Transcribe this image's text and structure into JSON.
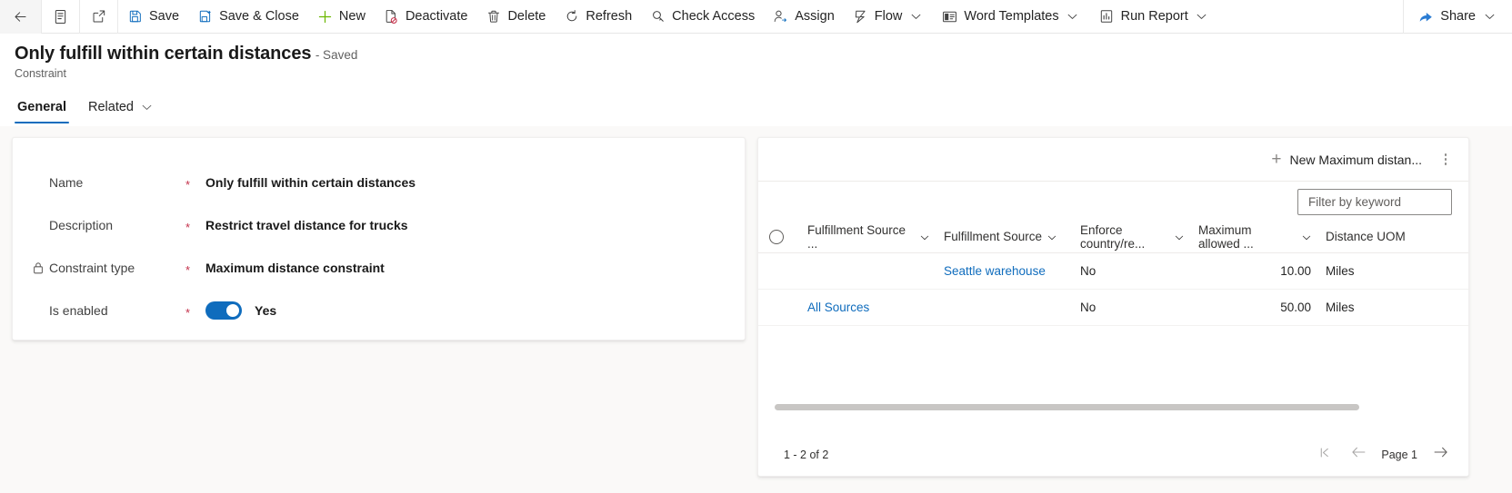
{
  "commandbar": {
    "back": {
      "label": "",
      "icon": "back-arrow-icon"
    },
    "form_selector": {
      "label": "",
      "icon": "form-list-icon"
    },
    "popout": {
      "label": "",
      "icon": "open-in-new-window-icon"
    },
    "buttons": [
      {
        "label": "Save",
        "icon": "save-icon"
      },
      {
        "label": "Save & Close",
        "icon": "save-and-close-icon"
      },
      {
        "label": "New",
        "icon": "plus-icon"
      },
      {
        "label": "Deactivate",
        "icon": "deactivate-icon"
      },
      {
        "label": "Delete",
        "icon": "trash-icon"
      },
      {
        "label": "Refresh",
        "icon": "refresh-icon"
      },
      {
        "label": "Check Access",
        "icon": "key-icon"
      },
      {
        "label": "Assign",
        "icon": "assign-person-icon"
      },
      {
        "label": "Flow",
        "icon": "flow-icon",
        "chevron": true
      },
      {
        "label": "Word Templates",
        "icon": "word-template-icon",
        "chevron": true
      },
      {
        "label": "Run Report",
        "icon": "report-icon",
        "chevron": true
      }
    ],
    "share": {
      "label": "Share",
      "icon": "share-icon",
      "chevron": true
    }
  },
  "header": {
    "title": "Only fulfill within certain distances",
    "saved_state": "- Saved",
    "entity": "Constraint"
  },
  "tabs": [
    {
      "label": "General",
      "active": true
    },
    {
      "label": "Related",
      "active": false,
      "chevron": true
    }
  ],
  "form": {
    "fields": [
      {
        "label": "Name",
        "required": "*",
        "value": "Only fulfill within certain distances",
        "locked": false,
        "type": "text"
      },
      {
        "label": "Description",
        "required": "*",
        "value": "Restrict travel distance for trucks",
        "locked": false,
        "type": "text"
      },
      {
        "label": "Constraint type",
        "required": "*",
        "value": "Maximum distance constraint",
        "locked": true,
        "type": "text"
      },
      {
        "label": "Is enabled",
        "required": "*",
        "value": "Yes",
        "locked": false,
        "type": "toggle",
        "toggle_on": true
      }
    ]
  },
  "subgrid": {
    "new_button_label": "New Maximum distan...",
    "more_commands_label": "More commands",
    "filter": {
      "placeholder": "Filter by keyword",
      "value": ""
    },
    "columns": [
      {
        "label": "Fulfillment Source ...",
        "chevron": true,
        "align": "left"
      },
      {
        "label": "Fulfillment Source",
        "chevron": true,
        "align": "left"
      },
      {
        "label": "Enforce country/re...",
        "chevron": true,
        "align": "left"
      },
      {
        "label": "Maximum allowed ...",
        "chevron": true,
        "align": "right"
      },
      {
        "label": "Distance UOM",
        "chevron": false,
        "align": "left"
      }
    ],
    "rows": [
      {
        "cells": [
          "",
          "Seattle warehouse",
          "No",
          "10.00",
          "Miles"
        ],
        "link_index": 1
      },
      {
        "cells": [
          "All Sources",
          "",
          "No",
          "50.00",
          "Miles"
        ],
        "link_index": 0
      }
    ],
    "pager": {
      "count_label": "1 - 2 of 2",
      "page_label": "Page 1",
      "first_page_icon": "first-page-icon",
      "previous_page_icon": "previous-page-arrow-icon",
      "next_page_icon": "next-page-arrow-icon"
    }
  },
  "colors": {
    "accent": "#0f6cbd",
    "required": "#c4314b",
    "link": "#0f6cbd",
    "canvas": "#faf9f8"
  }
}
